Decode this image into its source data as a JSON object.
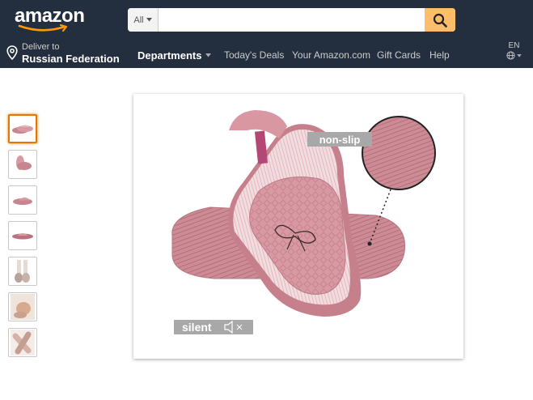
{
  "header": {
    "logo_text": "amazon",
    "search": {
      "dept_label": "All",
      "placeholder": "",
      "value": ""
    },
    "deliver": {
      "line1": "Deliver to",
      "line2": "Russian Federation"
    },
    "departments_label": "Departments",
    "nav_links": [
      "Today's Deals",
      "Your Amazon.com",
      "Gift Cards",
      "Help"
    ],
    "language": "EN"
  },
  "gallery": {
    "thumbnail_count": 7,
    "selected_index": 0
  },
  "main_image": {
    "callouts": {
      "non_slip": "non-slip",
      "silent": "silent"
    },
    "colors": {
      "slipper_pink": "#d4949e",
      "sole_pink": "#c57f8a",
      "callout_gray": "#a8a8a8"
    }
  },
  "colors": {
    "header_bg": "#232f3e",
    "search_button": "#febd69",
    "selected_border": "#e77600"
  }
}
